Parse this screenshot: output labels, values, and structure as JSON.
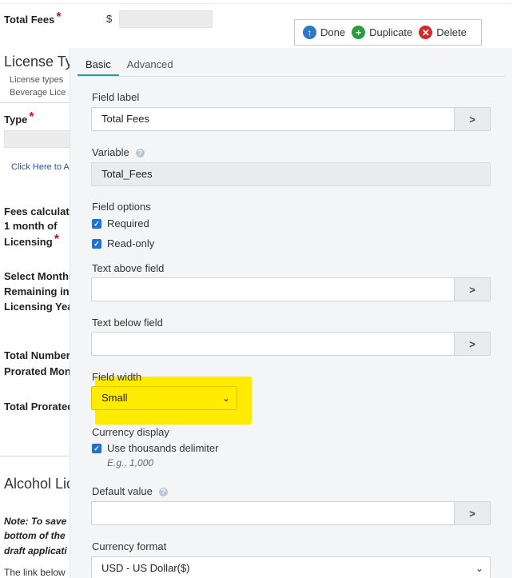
{
  "background_form": {
    "total_fees_label": "Total Fees",
    "currency_symbol": "$",
    "license_types_heading": "License Ty",
    "license_types_note_1": "License types",
    "license_types_note_2": "Beverage Lice",
    "type_label": "Type",
    "click_here_link": "Click Here to A",
    "fees_calc_label_1": "Fees calculate",
    "fees_calc_label_2": "1 month of",
    "fees_calc_label_3": "Licensing",
    "select_months_1": "Select Months",
    "select_months_2": "Remaining in",
    "select_months_3": "Licensing Yea",
    "total_number_1": "Total Number",
    "total_number_2": "Prorated Mon",
    "total_prorated": "Total Prorated",
    "alcohol_heading": "Alcohol Lic",
    "note_1": "Note:  To save",
    "note_2": "bottom of the",
    "note_3": "draft applicati",
    "link_below": "The link below",
    "required_mark": "*"
  },
  "toolbar": {
    "done_label": "Done",
    "duplicate_label": "Duplicate",
    "delete_label": "Delete"
  },
  "panel": {
    "tabs": [
      {
        "label": "Basic",
        "active": true
      },
      {
        "label": "Advanced",
        "active": false
      }
    ],
    "field_label": {
      "label": "Field label",
      "value": "Total Fees"
    },
    "variable": {
      "label": "Variable",
      "value": "Total_Fees"
    },
    "field_options": {
      "label": "Field options",
      "required": "Required",
      "read_only": "Read-only"
    },
    "text_above": {
      "label": "Text above field",
      "value": ""
    },
    "text_below": {
      "label": "Text below field",
      "value": ""
    },
    "field_width": {
      "label": "Field width",
      "value": "Small"
    },
    "currency_display": {
      "label": "Currency display",
      "use_thousands": "Use thousands delimiter",
      "example": "E.g., 1,000"
    },
    "default_value": {
      "label": "Default value",
      "value": ""
    },
    "currency_format": {
      "label": "Currency format",
      "value": "USD - US Dollar($)"
    }
  },
  "icons": {
    "arrow": ">",
    "chevron": "⌄",
    "check": "✓",
    "help": "?",
    "done": "↑",
    "duplicate": "+",
    "delete": "✕"
  },
  "colors": {
    "highlight": "#ffeb00",
    "tab_underline": "#2a9d9d",
    "checkbox": "#1f6fd6",
    "required": "#c8102e"
  }
}
